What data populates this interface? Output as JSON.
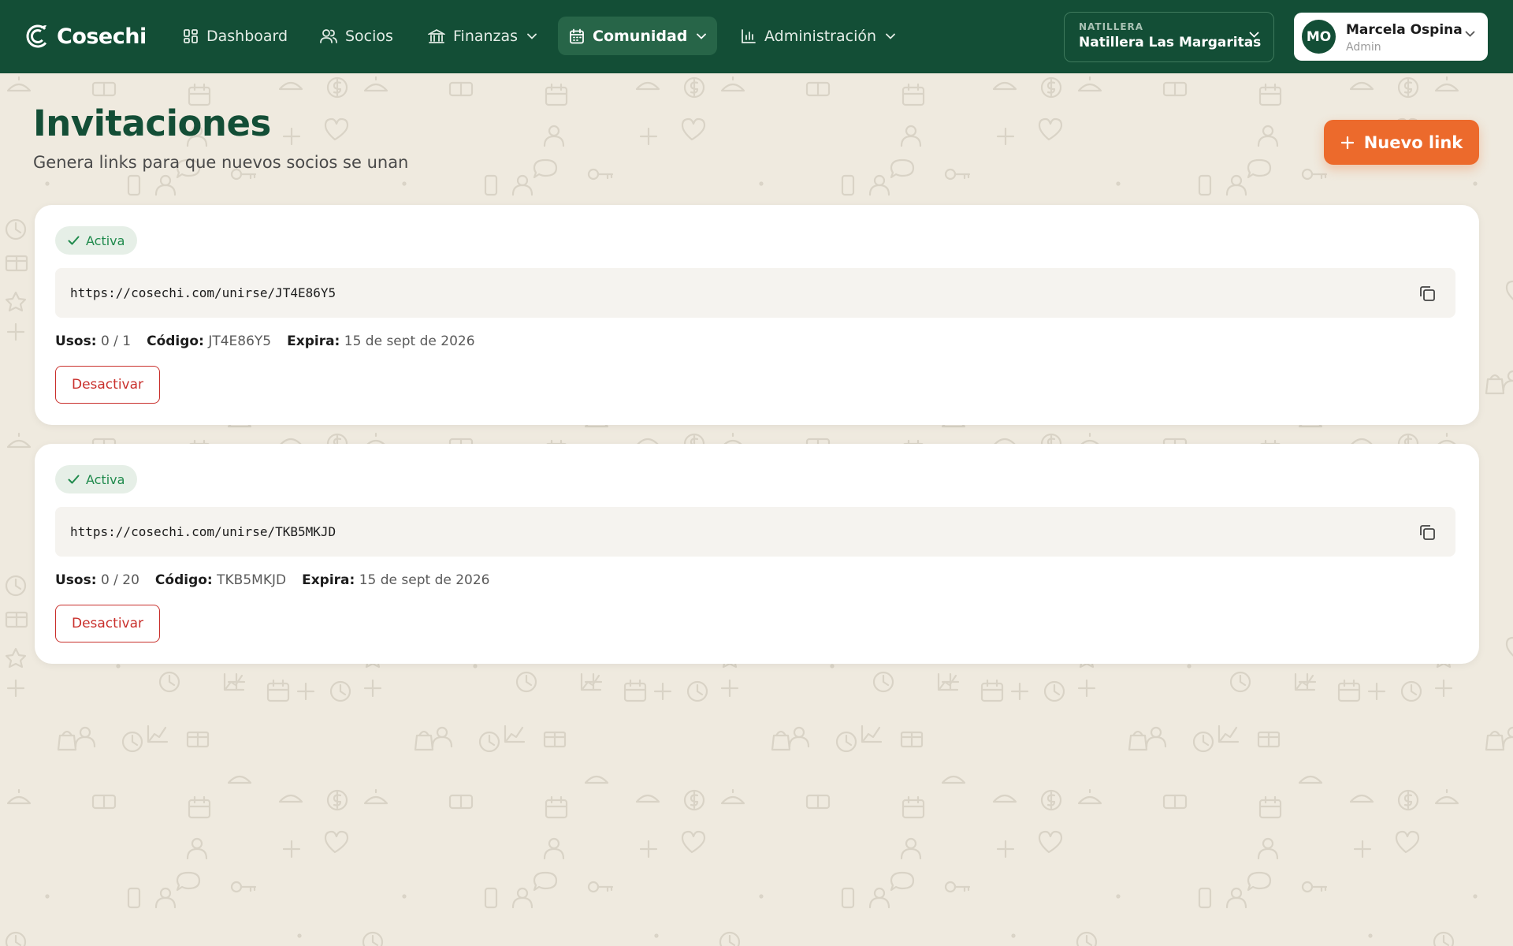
{
  "brand": {
    "name": "Cosechi"
  },
  "nav": {
    "items": [
      {
        "label": "Dashboard",
        "icon": "dashboard-icon",
        "active": false,
        "has_dropdown": false
      },
      {
        "label": "Socios",
        "icon": "users-icon",
        "active": false,
        "has_dropdown": false
      },
      {
        "label": "Finanzas",
        "icon": "bank-icon",
        "active": false,
        "has_dropdown": true
      },
      {
        "label": "Comunidad",
        "icon": "calendar-icon",
        "active": true,
        "has_dropdown": true
      },
      {
        "label": "Administración",
        "icon": "bar-chart-icon",
        "active": false,
        "has_dropdown": true
      }
    ],
    "org_selector": {
      "caption": "NATILLERA",
      "value": "Natillera Las Margaritas"
    },
    "user": {
      "initials": "MO",
      "name": "Marcela Ospina",
      "role": "Admin"
    }
  },
  "page": {
    "title": "Invitaciones",
    "subtitle": "Genera links para que nuevos socios se unan",
    "new_link_label": "Nuevo link"
  },
  "invitations": [
    {
      "status": "Activa",
      "url": "https://cosechi.com/unirse/JT4E86Y5",
      "uses_label": "Usos:",
      "uses_value": "0 / 1",
      "code_label": "Código:",
      "code_value": "JT4E86Y5",
      "expires_label": "Expira:",
      "expires_value": "15 de sept de 2026",
      "action_label": "Desactivar"
    },
    {
      "status": "Activa",
      "url": "https://cosechi.com/unirse/TKB5MKJD",
      "uses_label": "Usos:",
      "uses_value": "0 / 20",
      "code_label": "Código:",
      "code_value": "TKB5MKJD",
      "expires_label": "Expira:",
      "expires_value": "15 de sept de 2026",
      "action_label": "Desactivar"
    }
  ],
  "colors": {
    "nav_bg": "#134e36",
    "nav_active": "#276548",
    "accent": "#ec6a2c",
    "page_bg": "#efeadf",
    "status_green": "#1f8a4c",
    "danger": "#c9302c"
  }
}
